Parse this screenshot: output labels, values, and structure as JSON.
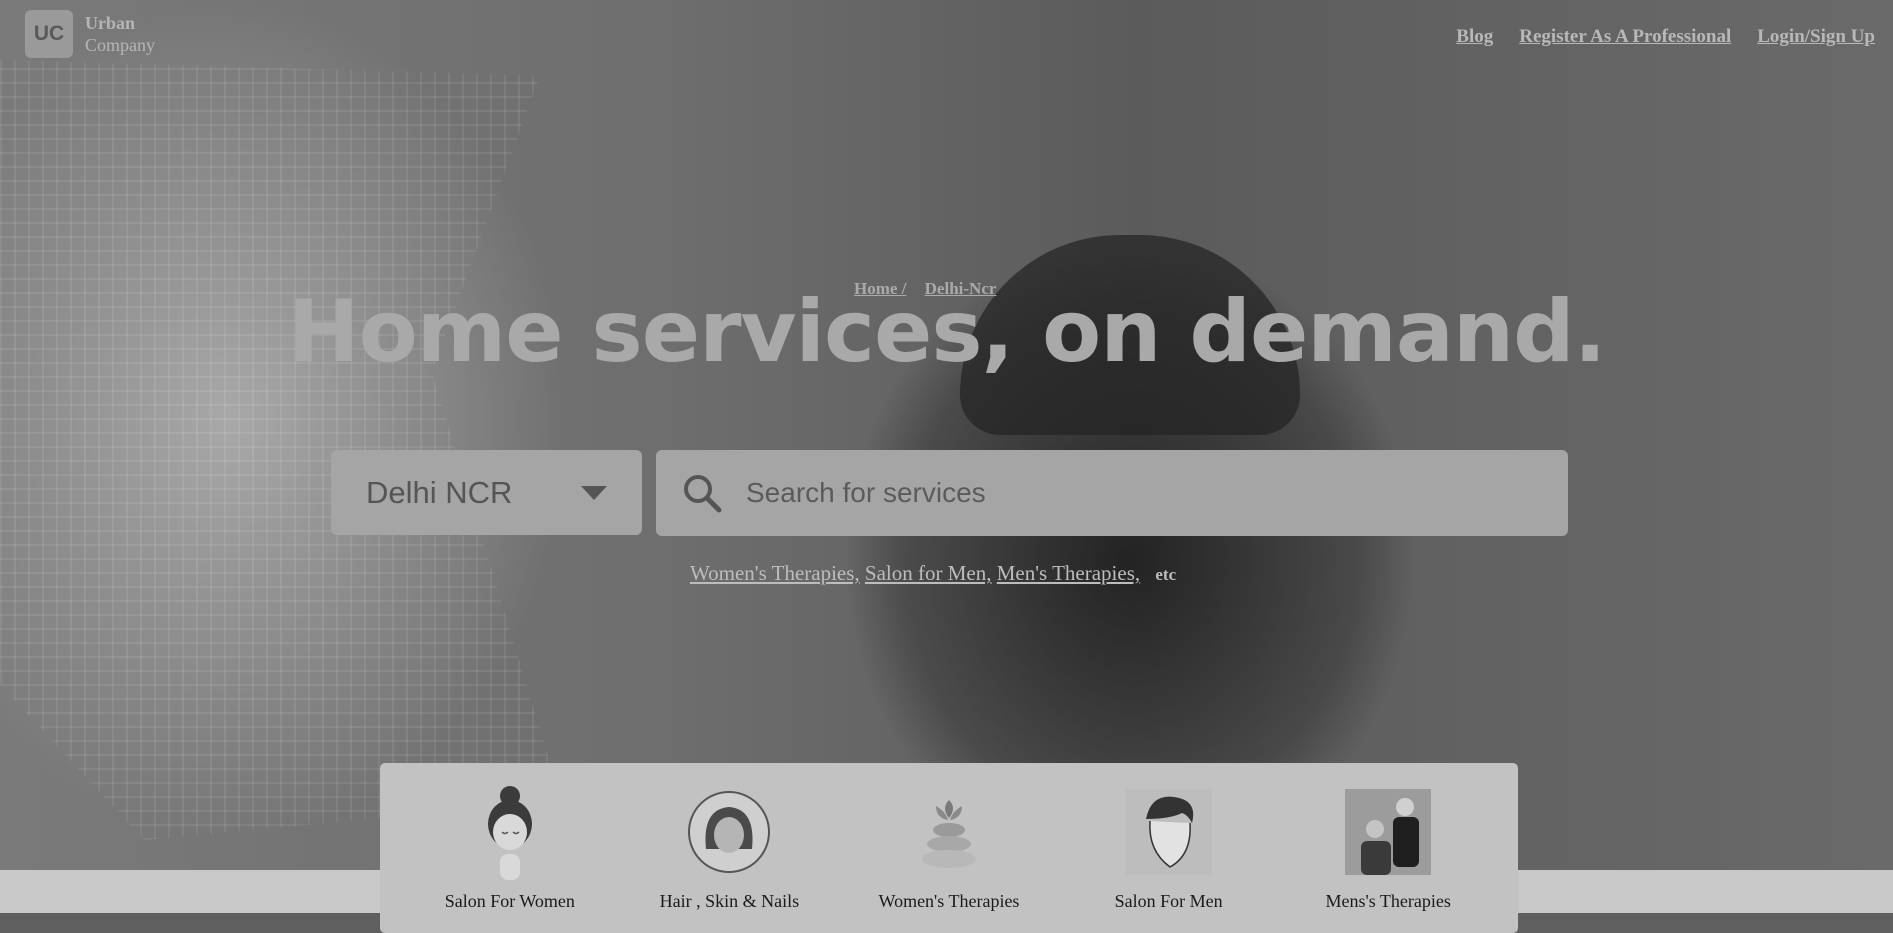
{
  "brand": {
    "logo_mark": "UC",
    "name_line1": "Urban",
    "name_line2": "Company"
  },
  "nav": {
    "items": [
      "Blog",
      "Register As A Professional",
      "Login/Sign Up"
    ]
  },
  "breadcrumb": {
    "home": "Home /",
    "current": "Delhi-Ncr"
  },
  "hero": {
    "headline": "Home services, on demand."
  },
  "city_select": {
    "value": "Delhi NCR",
    "icon": "chevron-down-icon"
  },
  "search": {
    "placeholder": "Search for services",
    "icon": "search-icon"
  },
  "quick_links": {
    "items": [
      "Women's Therapies,",
      "Salon for Men,",
      "Men's Therapies,"
    ],
    "etc": "etc"
  },
  "categories": [
    {
      "label": "Salon For Women",
      "icon": "woman-salon-icon"
    },
    {
      "label": "Hair , Skin & Nails",
      "icon": "woman-face-icon"
    },
    {
      "label": "Women's Therapies",
      "icon": "lotus-stones-icon"
    },
    {
      "label": "Salon For Men",
      "icon": "man-haircut-icon"
    },
    {
      "label": "Mens's Therapies",
      "icon": "therapist-photo-icon"
    }
  ]
}
